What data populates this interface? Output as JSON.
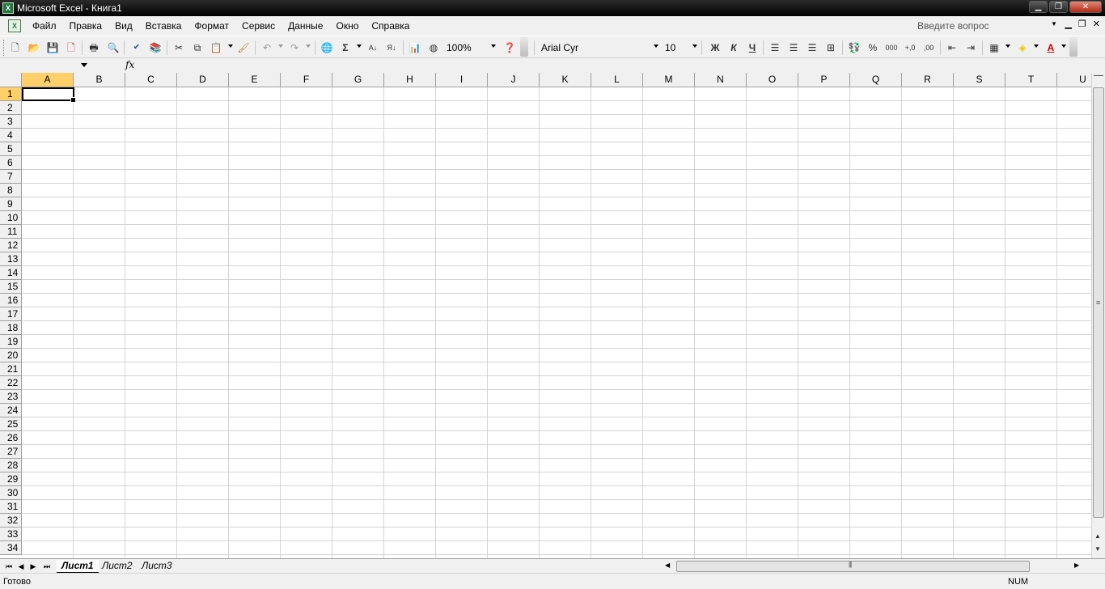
{
  "window": {
    "title": "Microsoft Excel - Книга1",
    "app_icon": "excel-icon"
  },
  "menu": {
    "items": [
      "Файл",
      "Правка",
      "Вид",
      "Вставка",
      "Формат",
      "Сервис",
      "Данные",
      "Окно",
      "Справка"
    ],
    "help_placeholder": "Введите вопрос"
  },
  "toolbar": {
    "zoom": "100%",
    "font_name": "Arial Cyr",
    "font_size": "10",
    "bold_label": "Ж",
    "italic_label": "К",
    "underline_label": "Ч",
    "sum_label": "Σ",
    "percent_label": "%",
    "thousands_label": "000"
  },
  "formula_bar": {
    "name_box": "",
    "fx_label": "fx",
    "formula": ""
  },
  "grid": {
    "columns": [
      "A",
      "B",
      "C",
      "D",
      "E",
      "F",
      "G",
      "H",
      "I",
      "J",
      "K",
      "L",
      "M",
      "N",
      "O",
      "P",
      "Q",
      "R",
      "S",
      "T",
      "U"
    ],
    "rows": [
      "1",
      "2",
      "3",
      "4",
      "5",
      "6",
      "7",
      "8",
      "9",
      "10",
      "11",
      "12",
      "13",
      "14",
      "15",
      "16",
      "17",
      "18",
      "19",
      "20",
      "21",
      "22",
      "23",
      "24",
      "25",
      "26",
      "27",
      "28",
      "29",
      "30",
      "31",
      "32",
      "33",
      "34"
    ],
    "active_cell": "A1"
  },
  "sheets": {
    "tabs": [
      "Лист1",
      "Лист2",
      "Лист3"
    ],
    "active": "Лист1"
  },
  "status": {
    "text": "Готово",
    "num": "NUM"
  },
  "colors": {
    "active_header": "#ffd06a",
    "grid_line": "#d4d4d4",
    "titlebar": "#000000"
  }
}
